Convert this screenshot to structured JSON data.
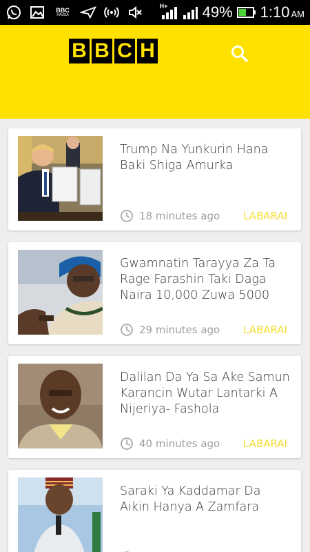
{
  "status_bar": {
    "icons": [
      "whatsapp-icon",
      "gallery-icon",
      "bbc-hausa-icon",
      "send-icon",
      "hotspot-icon",
      "mute-icon",
      "signal-h-plus-icon",
      "signal-icon",
      "battery-icon"
    ],
    "bbc_icon_text": "BBC",
    "bbc_icon_subtext": "HAUSA",
    "network_label": "H+",
    "battery": "49%",
    "time": "1:10",
    "ampm": "AM"
  },
  "app_bar": {
    "logo_letters": [
      "B",
      "B",
      "C",
      "H"
    ],
    "search_icon": "search-icon",
    "background": "#ffe100"
  },
  "articles": [
    {
      "title": "Trump Na Yunkurin Hana Baki Shiga Amurka",
      "time": "18 minutes ago",
      "category": "LABARAI"
    },
    {
      "title": "Gwamnatin Tarayya Za Ta Rage Farashin Taki Daga Naira 10,000 Zuwa 5000",
      "time": "29 minutes ago",
      "category": "LABARAI"
    },
    {
      "title": "Dalilan Da Ya Sa Ake Samun Karancin Wutar Lantarki A Nijeriya- Fashola",
      "time": "40 minutes ago",
      "category": "LABARAI"
    },
    {
      "title": "Saraki Ya Kaddamar Da Aikin Hanya A Zamfara",
      "time": "",
      "category": ""
    }
  ],
  "colors": {
    "accent": "#ffe100",
    "category": "#f4de32",
    "meta": "#9e9e9e"
  }
}
